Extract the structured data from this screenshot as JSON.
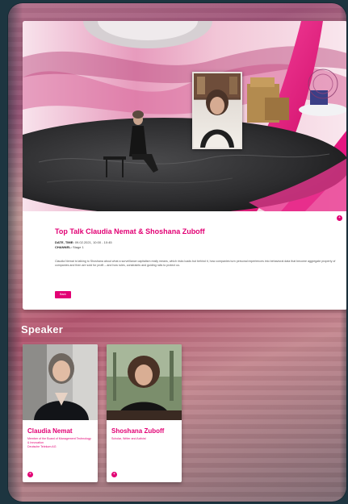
{
  "event": {
    "title": "Top Talk Claudia Nemat & Shoshana Zuboff",
    "date_label": "DATE, TIME:",
    "date_value": "09.02.2021, 10:00 - 10:45",
    "channel_label": "CHANNEL:",
    "channel_value": "Stage 1",
    "description": "Claudia Nemat is talking to Shoshana about what a surveillance capitalism really means, which risks loads but behind it, how companies turn personal experiences into behavioral data that become aggregate property of companies and then are sold for profit – and how rules, constraints and guiding rails to protect us.",
    "button_label": "Back",
    "corner_icon_glyph": "+"
  },
  "speaker_section": {
    "heading": "Speaker"
  },
  "speakers": [
    {
      "name": "Claudia Nemat",
      "role": "Member of the Board of Management Technology & Innovation",
      "company": "Deutsche Telekom AG",
      "more_glyph": "+"
    },
    {
      "name": "Shoshana Zuboff",
      "role": "Scholar, Writer and Activist",
      "company": "",
      "more_glyph": "+"
    }
  ],
  "colors": {
    "brand_magenta": "#e20074",
    "background": "#1d3540"
  }
}
